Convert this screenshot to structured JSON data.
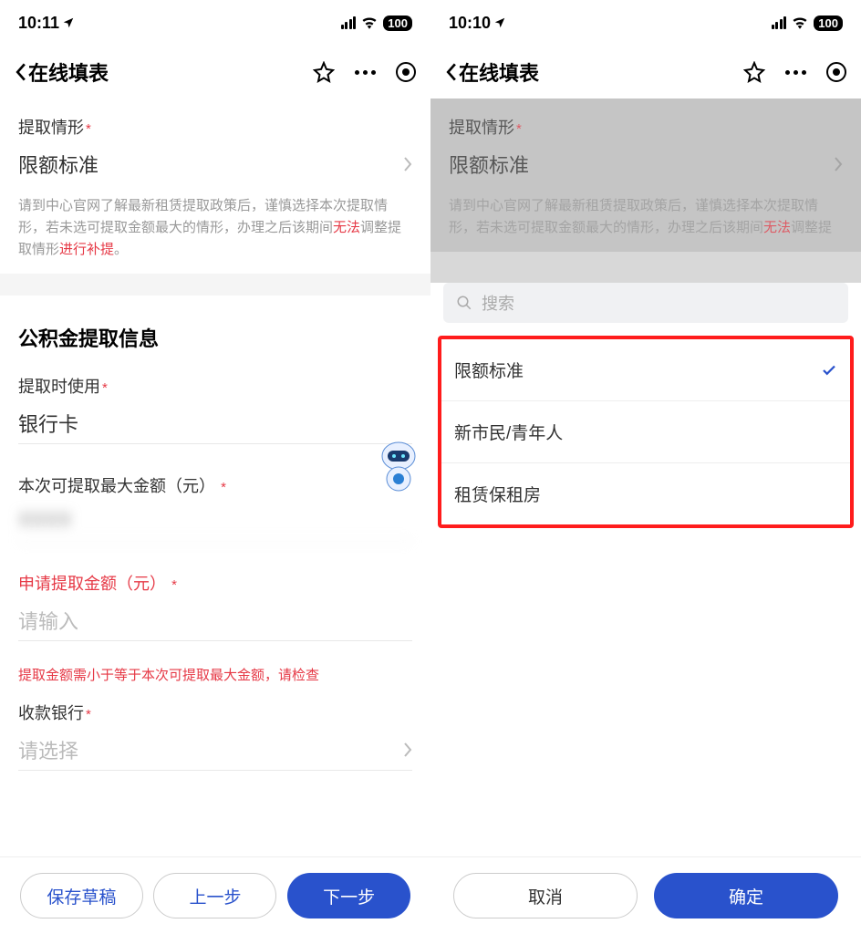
{
  "left": {
    "status": {
      "time": "10:11",
      "battery": "100"
    },
    "nav": {
      "title": "在线填表"
    },
    "scenario": {
      "label": "提取情形",
      "value": "限额标准",
      "hint_1": "请到中心官网了解最新租赁提取政策后，谨慎选择本次提取情形，若未选可提取金额最大的情形，办理之后该期间",
      "hint_red1": "无法",
      "hint_2": "调整提取情形",
      "hint_red2": "进行补提",
      "hint_3": "。"
    },
    "section_title": "公积金提取信息",
    "method": {
      "label": "提取时使用",
      "value": "银行卡"
    },
    "max": {
      "label": "本次可提取最大金额（元）",
      "value": "XXXX"
    },
    "apply": {
      "label": "申请提取金额（元）",
      "placeholder": "请输入"
    },
    "error_hint": "提取金额需小于等于本次可提取最大金额，请检查",
    "bank": {
      "label": "收款银行",
      "placeholder": "请选择"
    },
    "buttons": {
      "save": "保存草稿",
      "prev": "上一步",
      "next": "下一步"
    }
  },
  "right": {
    "status": {
      "time": "10:10",
      "battery": "100"
    },
    "nav": {
      "title": "在线填表"
    },
    "scenario": {
      "label": "提取情形",
      "value": "限额标准",
      "hint_1": "请到中心官网了解最新租赁提取政策后，谨慎选择本次提取情形，若未选可提取金额最大的情形，办理之后该期间",
      "hint_red1": "无法",
      "hint_2": "调整提"
    },
    "picker": {
      "search_placeholder": "搜索",
      "options": [
        "限额标准",
        "新市民/青年人",
        "租赁保租房"
      ],
      "selected_index": 0
    },
    "buttons": {
      "cancel": "取消",
      "confirm": "确定"
    }
  }
}
